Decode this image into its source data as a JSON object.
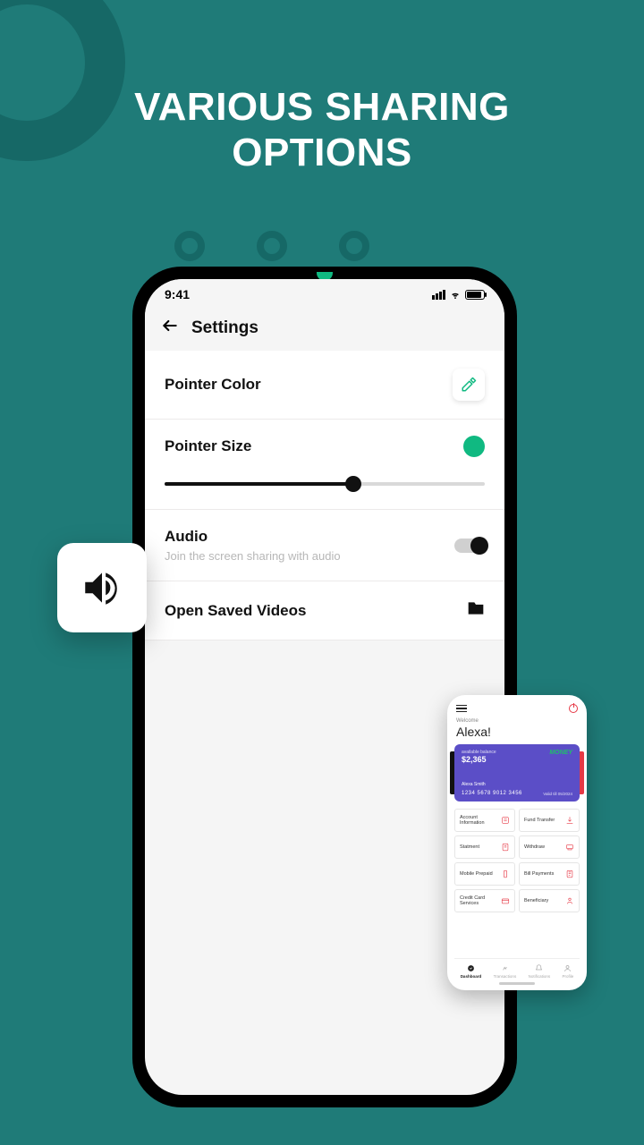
{
  "promo": {
    "title_line1": "VARIOUS SHARING",
    "title_line2": "OPTIONS"
  },
  "status": {
    "time": "9:41"
  },
  "header": {
    "title": "Settings"
  },
  "settings": {
    "pointer_color": {
      "label": "Pointer Color"
    },
    "pointer_size": {
      "label": "Pointer Size",
      "value_percent": 59
    },
    "audio": {
      "label": "Audio",
      "subtitle": "Join the screen sharing with audio",
      "on": true
    },
    "open_saved": {
      "label": "Open Saved Videos"
    }
  },
  "mini": {
    "welcome": "Welcome",
    "name": "Alexa!",
    "card": {
      "available_label": "available balance",
      "balance": "$2,365",
      "brand": "MONEY",
      "holder": "Alexa Smith",
      "number": "1234  5678  9012  3456",
      "expiry": "Valid till 05/2024"
    },
    "grid": [
      {
        "label": "Account Information"
      },
      {
        "label": "Fund Transfer"
      },
      {
        "label": "Statment"
      },
      {
        "label": "Withdraw"
      },
      {
        "label": "Mobile Prepaid"
      },
      {
        "label": "Bill Payments"
      },
      {
        "label": "Credit Card Services"
      },
      {
        "label": "Beneficiary"
      }
    ],
    "tabs": [
      {
        "label": "Dashboard",
        "active": true
      },
      {
        "label": "Transactions",
        "active": false
      },
      {
        "label": "Notifications",
        "active": false
      },
      {
        "label": "Profile",
        "active": false
      }
    ]
  }
}
